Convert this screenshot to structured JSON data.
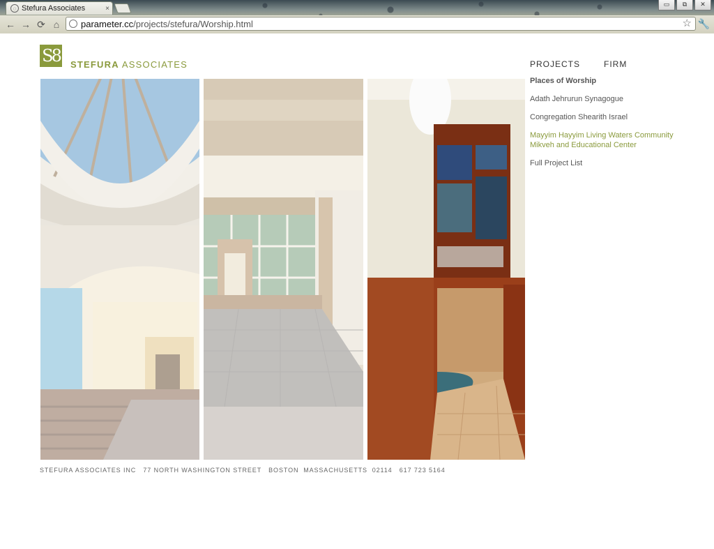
{
  "browser": {
    "tab_title": "Stefura Associates",
    "tab_close": "×",
    "url_host": "parameter.cc",
    "url_path": "/projects/stefura/Worship.html",
    "window_minimize": "▭",
    "window_restore": "⧉",
    "window_close": "✕"
  },
  "site": {
    "brand_mark": "S8",
    "brand_name_bold": "STEFURA",
    "brand_name_rest": " ASSOCIATES",
    "accent_color": "#8a9a3c"
  },
  "nav": {
    "projects": "PROJECTS",
    "firm": "FIRM"
  },
  "submenu": {
    "heading": "Places of Worship",
    "items": [
      {
        "label": "Adath Jehrurun Synagogue"
      },
      {
        "label": "Congregation Shearith Israel"
      },
      {
        "label": "Mayyim Hayyim Living Waters Community Mikveh and Educational Center"
      },
      {
        "label": "Full Project List"
      }
    ]
  },
  "footer": "STEFURA ASSOCIATES INC   77 NORTH WASHINGTON STREET   BOSTON  MASSACHUSETTS  02114   617 723 5164"
}
